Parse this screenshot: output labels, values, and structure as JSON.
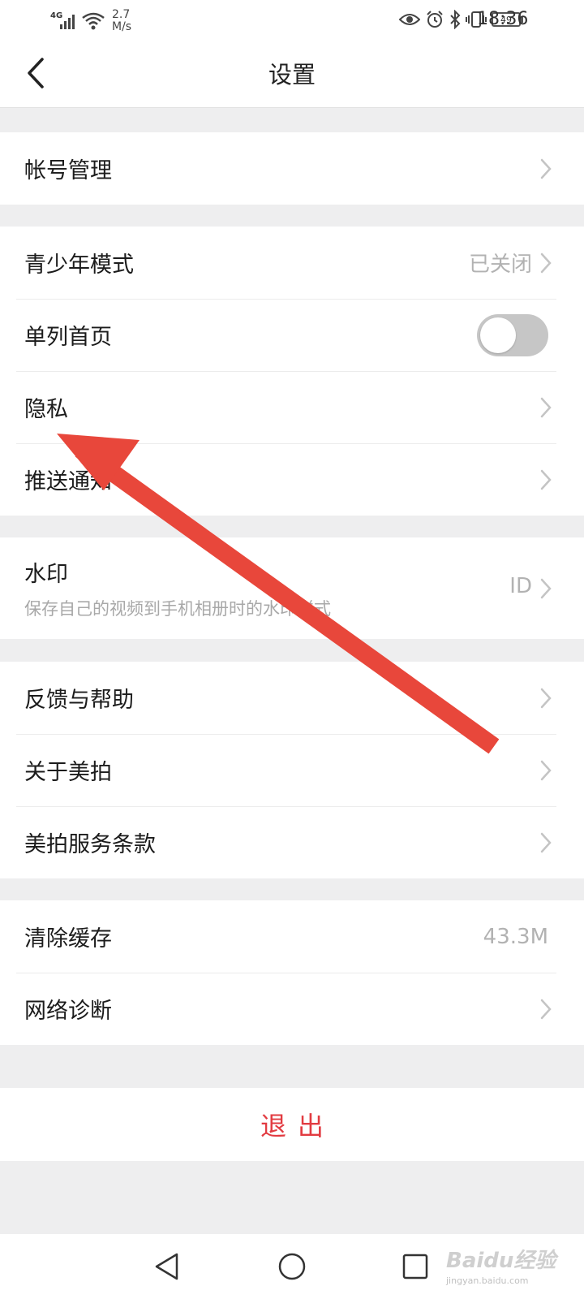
{
  "status_bar": {
    "network": "4G",
    "speed_value": "2.7",
    "speed_unit": "M/s",
    "battery": "49",
    "time": "18:36"
  },
  "header": {
    "title": "设置"
  },
  "groups": [
    {
      "items": [
        {
          "label": "帐号管理"
        }
      ]
    },
    {
      "items": [
        {
          "label": "青少年模式",
          "value": "已关闭"
        },
        {
          "label": "单列首页",
          "toggle_on": false
        },
        {
          "label": "隐私"
        },
        {
          "label": "推送通知"
        }
      ]
    },
    {
      "items": [
        {
          "label": "水印",
          "sub": "保存自己的视频到手机相册时的水印样式",
          "value": "ID"
        }
      ]
    },
    {
      "items": [
        {
          "label": "反馈与帮助"
        },
        {
          "label": "关于美拍"
        },
        {
          "label": "美拍服务条款"
        }
      ]
    },
    {
      "items": [
        {
          "label": "清除缓存",
          "value": "43.3M"
        },
        {
          "label": "网络诊断"
        }
      ]
    }
  ],
  "logout": {
    "label": "退出"
  },
  "watermark": {
    "main": "Baidu经验",
    "sub": "jingyan.baidu.com"
  },
  "colors": {
    "accent_red": "#e23b41",
    "annotation_arrow": "#e8473b",
    "background": "#eeeeef"
  },
  "icons": {
    "back": "chevron-left-icon",
    "row_arrow": "chevron-right-icon",
    "system_back": "triangle-back-icon",
    "system_home": "circle-home-icon",
    "system_recent": "square-recent-icon"
  }
}
